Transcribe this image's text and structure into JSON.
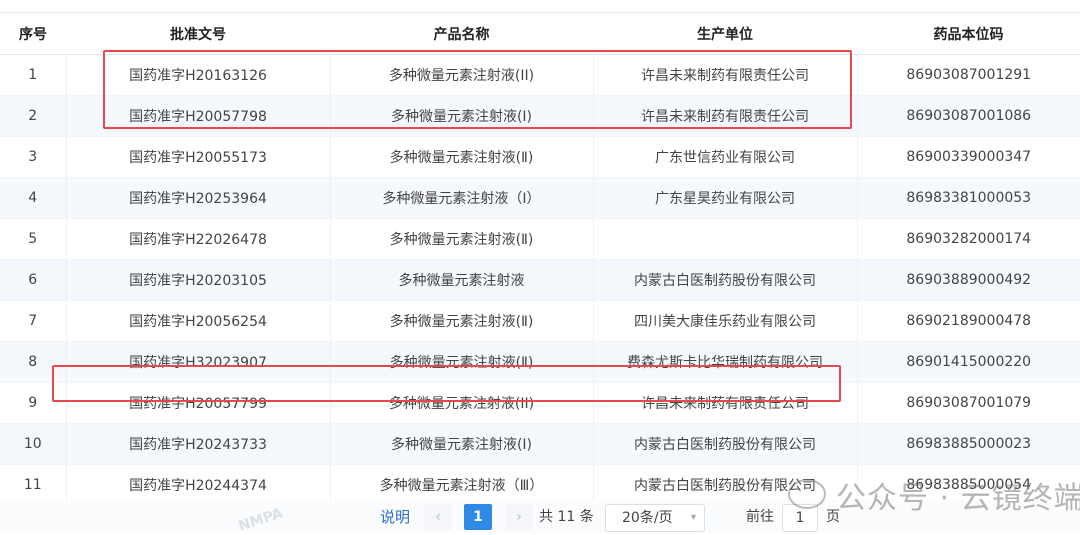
{
  "table": {
    "headers": [
      "序号",
      "批准文号",
      "产品名称",
      "生产单位",
      "药品本位码"
    ],
    "rows": [
      {
        "no": "1",
        "approval": "国药准字H20163126",
        "product": "多种微量元素注射液(II)",
        "maker": "许昌未来制药有限责任公司",
        "code": "86903087001291"
      },
      {
        "no": "2",
        "approval": "国药准字H20057798",
        "product": "多种微量元素注射液(I)",
        "maker": "许昌未来制药有限责任公司",
        "code": "86903087001086"
      },
      {
        "no": "3",
        "approval": "国药准字H20055173",
        "product": "多种微量元素注射液(Ⅱ)",
        "maker": "广东世信药业有限公司",
        "code": "86900339000347"
      },
      {
        "no": "4",
        "approval": "国药准字H20253964",
        "product": "多种微量元素注射液（I）",
        "maker": "广东星昊药业有限公司",
        "code": "86983381000053"
      },
      {
        "no": "5",
        "approval": "国药准字H22026478",
        "product": "多种微量元素注射液(Ⅱ)",
        "maker": "",
        "code": "86903282000174"
      },
      {
        "no": "6",
        "approval": "国药准字H20203105",
        "product": "多种微量元素注射液",
        "maker": "内蒙古白医制药股份有限公司",
        "code": "86903889000492"
      },
      {
        "no": "7",
        "approval": "国药准字H20056254",
        "product": "多种微量元素注射液(Ⅱ)",
        "maker": "四川美大康佳乐药业有限公司",
        "code": "86902189000478"
      },
      {
        "no": "8",
        "approval": "国药准字H32023907",
        "product": "多种微量元素注射液(Ⅱ)",
        "maker": "费森尤斯卡比华瑞制药有限公司",
        "code": "86901415000220"
      },
      {
        "no": "9",
        "approval": "国药准字H20057799",
        "product": "多种微量元素注射液(II)",
        "maker": "许昌未来制药有限责任公司",
        "code": "86903087001079"
      },
      {
        "no": "10",
        "approval": "国药准字H20243733",
        "product": "多种微量元素注射液(Ⅰ)",
        "maker": "内蒙古白医制药股份有限公司",
        "code": "86983885000023"
      },
      {
        "no": "11",
        "approval": "国药准字H20244374",
        "product": "多种微量元素注射液（Ⅲ）",
        "maker": "内蒙古白医制药股份有限公司",
        "code": "86983885000054"
      }
    ]
  },
  "pagination": {
    "help": "说明",
    "prev": "‹",
    "current_page": "1",
    "next": "›",
    "total": "共 11 条",
    "page_size": "20条/页",
    "goto_label": "前往",
    "goto_value": "1",
    "goto_unit": "页"
  },
  "watermark": {
    "text": "公众号 · 云镜终端",
    "stamp": "NMPA"
  },
  "colors": {
    "highlight": "#e5484d",
    "accent": "#2f8ae6"
  }
}
